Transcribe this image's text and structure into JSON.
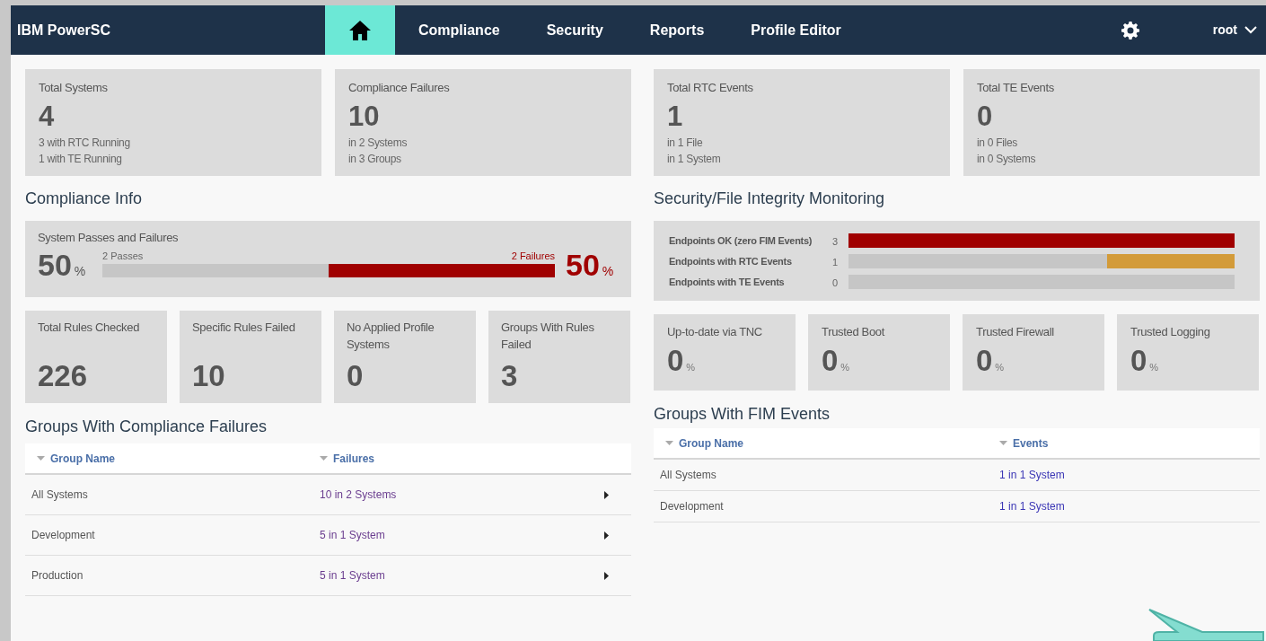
{
  "nav": {
    "brand": "IBM PowerSC",
    "items": [
      {
        "kind": "home",
        "selected": true
      },
      {
        "kind": "text",
        "label": "Compliance",
        "selected": false
      },
      {
        "kind": "text",
        "label": "Security",
        "selected": false
      },
      {
        "kind": "text",
        "label": "Reports",
        "selected": false
      },
      {
        "kind": "text",
        "label": "Profile Editor",
        "selected": false
      }
    ],
    "user": "root"
  },
  "left": {
    "stat_cards": [
      {
        "title": "Total Systems",
        "value": "4",
        "lines": [
          "3 with RTC Running",
          "1 with TE Running"
        ]
      },
      {
        "title": "Compliance Failures",
        "value": "10",
        "lines": [
          "in 2 Systems",
          "in 3 Groups"
        ]
      }
    ],
    "title": "Compliance Info",
    "pass_fail": {
      "title": "System Passes and Failures",
      "pass_value": "50",
      "pass_unit": "%",
      "passes_label": "2 Passes",
      "failures_label": "2 Failures",
      "fail_value": "50",
      "fail_unit": "%",
      "level": 0.5
    },
    "metric_cards": [
      {
        "title": "Total Rules Checked",
        "value": "226"
      },
      {
        "title": "Specific Rules Failed",
        "value": "10"
      },
      {
        "title": "No Applied Profile Systems",
        "value": "0"
      },
      {
        "title": "Groups With Rules Failed",
        "value": "3"
      }
    ],
    "table": {
      "title": "Groups With Compliance Failures",
      "columns": [
        "Group Name",
        "Failures"
      ],
      "rows": [
        {
          "name": "All Systems",
          "value": "10 in 2 Systems"
        },
        {
          "name": "Development",
          "value": "5 in 1 System"
        },
        {
          "name": "Production",
          "value": "5 in 1 System"
        }
      ]
    }
  },
  "right": {
    "stat_cards": [
      {
        "title": "Total RTC Events",
        "value": "1",
        "lines": [
          "in 1 File",
          "in 1 System"
        ]
      },
      {
        "title": "Total TE Events",
        "value": "0",
        "lines": [
          "in 0 Files",
          "in 0 Systems"
        ]
      }
    ],
    "title": "Security/File Integrity Monitoring",
    "bars": [
      {
        "label": "Endpoints OK (zero FIM Events)",
        "count": "3",
        "level": 1,
        "color": "#a00000"
      },
      {
        "label": "Endpoints with RTC Events",
        "count": "1",
        "level": 0.33,
        "color": "#d39b39"
      },
      {
        "label": "Endpoints with TE Events",
        "count": "0"
      }
    ],
    "metric_cards": [
      {
        "title": "Up-to-date via TNC",
        "value": "0",
        "unit": "%"
      },
      {
        "title": "Trusted Boot",
        "value": "0",
        "unit": "%"
      },
      {
        "title": "Trusted Firewall",
        "value": "0",
        "unit": "%"
      },
      {
        "title": "Trusted Logging",
        "value": "0",
        "unit": "%"
      }
    ],
    "table": {
      "title": "Groups With FIM Events",
      "columns": [
        "Group Name",
        "Events"
      ],
      "rows": [
        {
          "name": "All Systems",
          "value": "1 in 1 System"
        },
        {
          "name": "Development",
          "value": "1 in 1 System"
        }
      ]
    }
  }
}
